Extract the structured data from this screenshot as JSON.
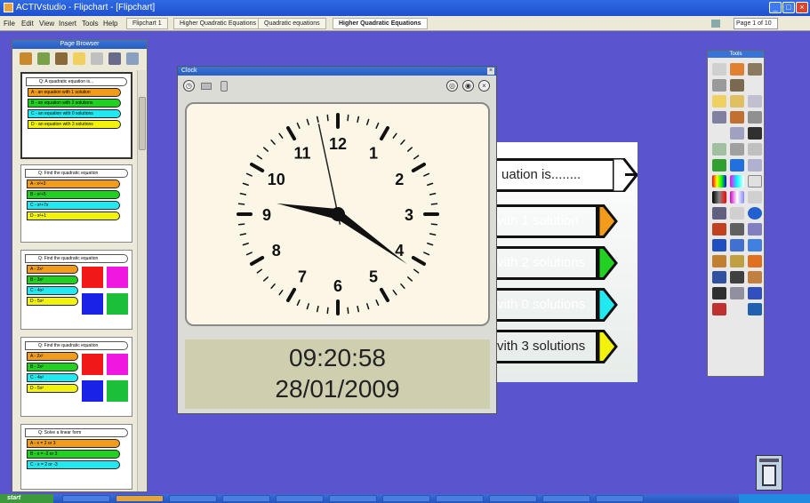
{
  "window": {
    "title": "ACTIVstudio - Flipchart - [Flipchart]"
  },
  "menu": {
    "items": [
      "File",
      "Edit",
      "View",
      "Insert",
      "Tools",
      "Help"
    ],
    "tabs": [
      "Flipchart 1",
      "Higher Quadratic Equations",
      "Quadratic equations",
      "Higher Quadratic Equations"
    ],
    "page_indicator": "Page 1 of 10"
  },
  "sorter": {
    "title": "Page Browser",
    "pages": [
      {
        "question": "Q: A quadratic equation is...",
        "options": [
          "A - an equation with 1 solution",
          "B - an equation with 2 solutions",
          "C - an equation with 0 solutions",
          "D - an equation with 3 solutions"
        ]
      },
      {
        "question": "Q: Find the quadratic equation",
        "options": [
          "A - x²+3",
          "B - x²+5",
          "C - x²+7x",
          "D - x²+1"
        ]
      },
      {
        "question": "Q: Find the quadratic equation",
        "options": [
          "A - 2x²",
          "B - 3x²",
          "C - 4x²",
          "D - 5x²"
        ]
      },
      {
        "question": "Q: Find the quadratic equation",
        "options": [
          "A - 2x²",
          "B - 3x²",
          "C - 4x²",
          "D - 5x²"
        ]
      },
      {
        "question": "Q: Solve a linear form",
        "options": [
          "A - x = 2 or 3",
          "B - x = -2 or 3",
          "C - x = 2 or -3"
        ]
      }
    ]
  },
  "clock": {
    "window_title": "Clock",
    "time": "09:20:58",
    "date": "28/01/2009",
    "hour": 9,
    "minute": 20,
    "second": 58,
    "numbers": [
      "12",
      "1",
      "2",
      "3",
      "4",
      "5",
      "6",
      "7",
      "8",
      "9",
      "10",
      "11"
    ]
  },
  "slide": {
    "question": "uation is........",
    "options": [
      {
        "text": "vith 1 solution",
        "color": "#f39b1a"
      },
      {
        "text": "vith 2 solutions",
        "color": "#22d022"
      },
      {
        "text": "vith 0 solutions",
        "color": "#22e8f0"
      },
      {
        "text": "vith 3 solutions",
        "color": "#f2f20a"
      }
    ]
  },
  "palette": {
    "title": "Tools"
  },
  "taskbar": {
    "start_label": "start"
  }
}
